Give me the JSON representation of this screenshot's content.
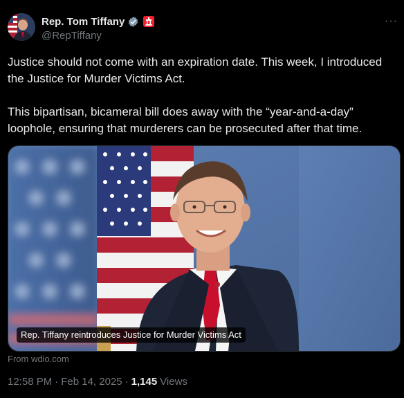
{
  "author": {
    "name": "Rep. Tom Tiffany",
    "handle": "@RepTiffany",
    "verified_icon": "verified-check-icon",
    "gov_badge_icon": "government-badge-icon"
  },
  "tweet": {
    "paragraph1": "Justice should not come with an expiration date. This week, I introduced the Justice for Murder Victims Act.",
    "paragraph2": "This bipartisan, bicameral bill does away with the “year-and-a-day” loophole, ensuring that murderers can be prosecuted after that time."
  },
  "card": {
    "caption": "Rep. Tiffany reintroduces Justice for Murder Victims Act",
    "source": "From wdio.com"
  },
  "meta": {
    "time": "12:58 PM",
    "separator": "·",
    "date": "Feb 14, 2025",
    "separator2": "·",
    "views_count": "1,145",
    "views_label": "Views"
  },
  "more_icon": "more-options-icon",
  "more_glyph": "···",
  "colors": {
    "background": "#000000",
    "text": "#e7e9ea",
    "secondary": "#71767b",
    "verified": "#829aab",
    "badge": "#f4212e"
  }
}
